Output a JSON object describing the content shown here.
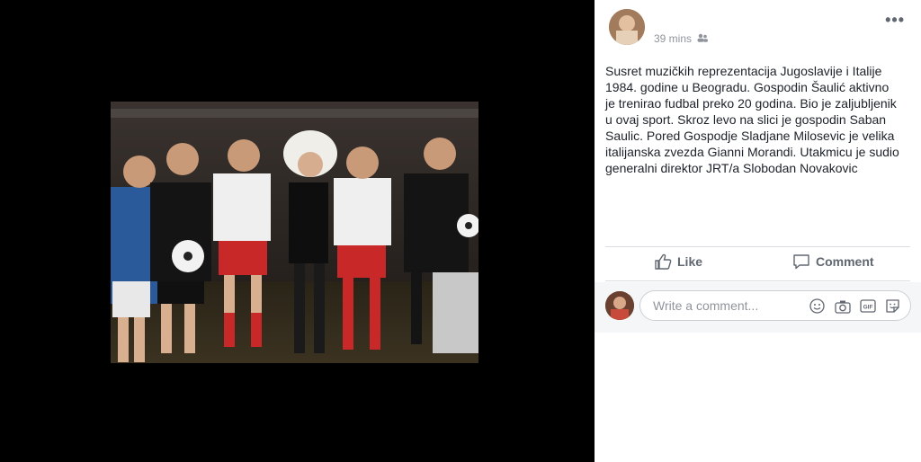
{
  "post": {
    "time": "39 mins",
    "audience_icon": "friends-icon",
    "text": "Susret muzičkih reprezentacija Jugoslavije i Italije\n1984. godine u Beogradu. Gospodin Šaulić aktivno\nje trenirao fudbal preko 20 godina. Bio je zaljubljenik\nu ovaj sport. Skroz levo na slici je gospodin Saban\nSaulic. Pored Gospodje Sladjane Milosevic je velika\nitalijanska zvezda Gianni Morandi. Utakmicu je sudio\ngeneralni direktor JRT/a Slobodan Novakovic"
  },
  "actions": {
    "like_label": "Like",
    "comment_label": "Comment"
  },
  "comment_box": {
    "placeholder": "Write a comment..."
  },
  "colors": {
    "panel_bg": "#ffffff",
    "viewer_bg": "#000000",
    "meta_text": "#90949c",
    "body_text": "#1d2129"
  }
}
